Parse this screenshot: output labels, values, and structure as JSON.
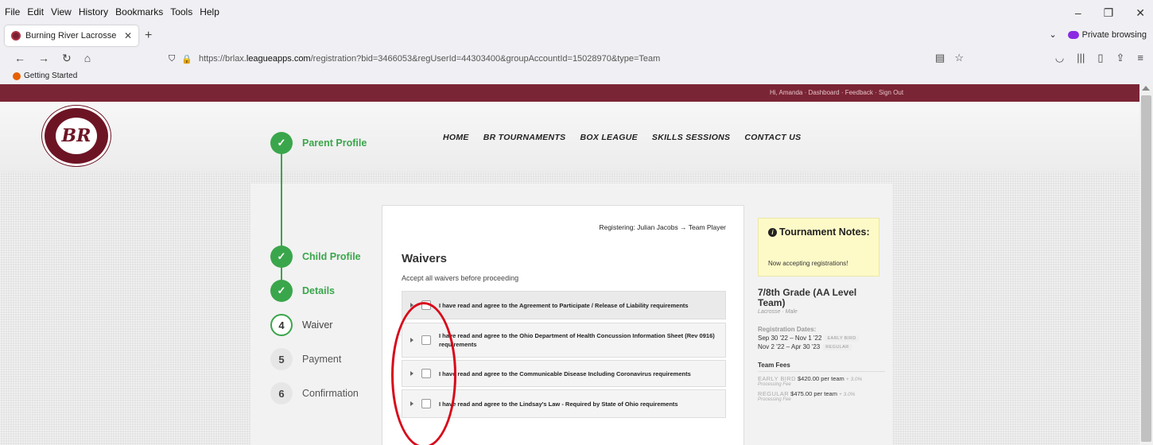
{
  "browser": {
    "menu": [
      "File",
      "Edit",
      "View",
      "History",
      "Bookmarks",
      "Tools",
      "Help"
    ],
    "tab_title": "Burning River Lacrosse : Program",
    "private_label": "Private browsing",
    "url_prefix": "https://brlax.",
    "url_domain": "leagueapps.com",
    "url_rest": "/registration?bid=3466053&regUserId=44303400&groupAccountId=15028970&type=Team",
    "bookmark": "Getting Started"
  },
  "site": {
    "top_links": "Hi, Amanda · Dashboard · Feedback · Sign Out",
    "logo_mark": "BR",
    "nav": [
      "HOME",
      "BR TOURNAMENTS",
      "BOX LEAGUE",
      "SKILLS SESSIONS",
      "CONTACT US"
    ]
  },
  "steps": [
    {
      "num": "✓",
      "label": "Parent Profile",
      "state": "done"
    },
    {
      "num": "✓",
      "label": "Child Profile",
      "state": "done"
    },
    {
      "num": "✓",
      "label": "Details",
      "state": "done"
    },
    {
      "num": "4",
      "label": "Waiver",
      "state": "current"
    },
    {
      "num": "5",
      "label": "Payment",
      "state": "todo"
    },
    {
      "num": "6",
      "label": "Confirmation",
      "state": "todo"
    }
  ],
  "waivers": {
    "registering": "Registering: Julian Jacobs → Team Player",
    "title": "Waivers",
    "subtitle": "Accept all waivers before proceeding",
    "items": [
      "I have read and agree to the Agreement to Participate / Release of Liability requirements",
      "I have read and agree to the Ohio Department of Health Concussion Information Sheet (Rev 0916) requirements",
      "I have read and agree to the Communicable Disease Including Coronavirus requirements",
      "I have read and agree to the Lindsay's Law - Required by State of Ohio requirements"
    ]
  },
  "sidebar": {
    "notes_title": "Tournament Notes:",
    "notes_text": "Now accepting registrations!",
    "program_title": "7/8th Grade (AA Level Team)",
    "program_sub": "Lacrosse · Male",
    "reg_dates_label": "Registration Dates:",
    "dates": [
      {
        "range": "Sep 30 '22 – Nov 1 '22",
        "badge": "EARLY BIRD"
      },
      {
        "range": "Nov 2 '22 – Apr 30 '23",
        "badge": "REGULAR"
      }
    ],
    "fees_label": "Team Fees",
    "fees": [
      {
        "tier": "EARLY BIRD",
        "amount": "$420.00 per team",
        "pct": "+ 3.0%",
        "note": "Processing Fee"
      },
      {
        "tier": "REGULAR",
        "amount": "$475.00 per team",
        "pct": "+ 3.0%",
        "note": "Processing Fee"
      }
    ]
  },
  "colors": {
    "brand": "#7a2535",
    "success": "#3aa64b",
    "annotation": "#d8081a"
  }
}
